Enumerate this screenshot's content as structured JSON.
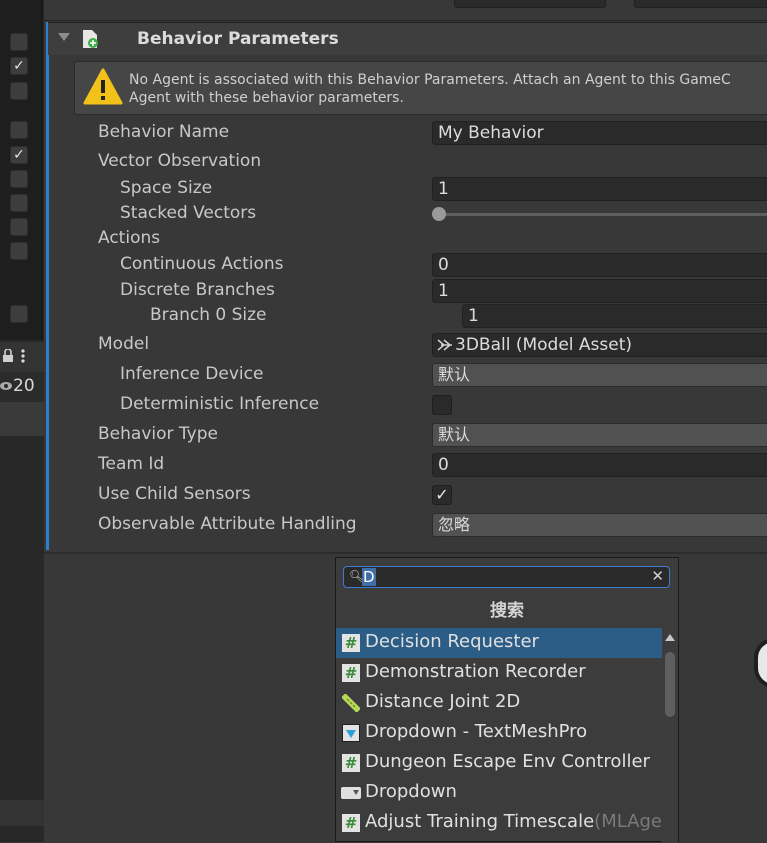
{
  "left_panel": {
    "checkboxes": [
      "",
      "✓",
      "",
      "",
      "✓",
      "",
      "",
      "",
      "",
      "",
      "",
      ""
    ],
    "toolbar": {
      "lock_icon": "lock-icon",
      "more_icon": "kebab-menu-icon"
    },
    "visibility_count": "20"
  },
  "inspector": {
    "component_title": "Behavior Parameters",
    "warning": {
      "text": "No Agent is associated with this Behavior Parameters. Attach an Agent to this GameC\nAgent with these behavior parameters."
    },
    "properties": {
      "behavior_name_label": "Behavior Name",
      "behavior_name_value": "My Behavior",
      "vector_observation_label": "Vector Observation",
      "space_size_label": "Space Size",
      "space_size_value": "1",
      "stacked_vectors_label": "Stacked Vectors",
      "stacked_vectors_value": 1,
      "actions_label": "Actions",
      "continuous_actions_label": "Continuous Actions",
      "continuous_actions_value": "0",
      "discrete_branches_label": "Discrete Branches",
      "discrete_branches_value": "1",
      "branch0_label": "Branch 0 Size",
      "branch0_value": "1",
      "model_label": "Model",
      "model_value": "3DBall (Model Asset)",
      "inference_device_label": "Inference Device",
      "inference_device_value": "默认",
      "deterministic_label": "Deterministic Inference",
      "deterministic_checked": false,
      "behavior_type_label": "Behavior Type",
      "behavior_type_value": "默认",
      "team_id_label": "Team Id",
      "team_id_value": "0",
      "use_child_sensors_label": "Use Child Sensors",
      "use_child_sensors_checked": "✓",
      "observable_label": "Observable Attribute Handling",
      "observable_value": "忽略"
    }
  },
  "add_component_popup": {
    "search_value": "D",
    "title": "搜索",
    "items": [
      {
        "label": "Decision Requester",
        "suffix": "",
        "icon": "script-icon",
        "selected": true
      },
      {
        "label": "Demonstration Recorder",
        "suffix": "",
        "icon": "script-icon",
        "selected": false
      },
      {
        "label": "Distance Joint 2D",
        "suffix": "",
        "icon": "ruler-icon",
        "selected": false
      },
      {
        "label": "Dropdown - TextMeshPro",
        "suffix": "",
        "icon": "tmp-dropdown-icon",
        "selected": false
      },
      {
        "label": "Dungeon Escape Env Controller",
        "suffix": "",
        "icon": "script-icon",
        "selected": false
      },
      {
        "label": "Dropdown",
        "suffix": "",
        "icon": "dropdown-icon",
        "selected": false
      },
      {
        "label": "Adjust Training Timescale",
        "suffix": "(MLAge",
        "icon": "script-icon",
        "selected": false
      }
    ]
  }
}
